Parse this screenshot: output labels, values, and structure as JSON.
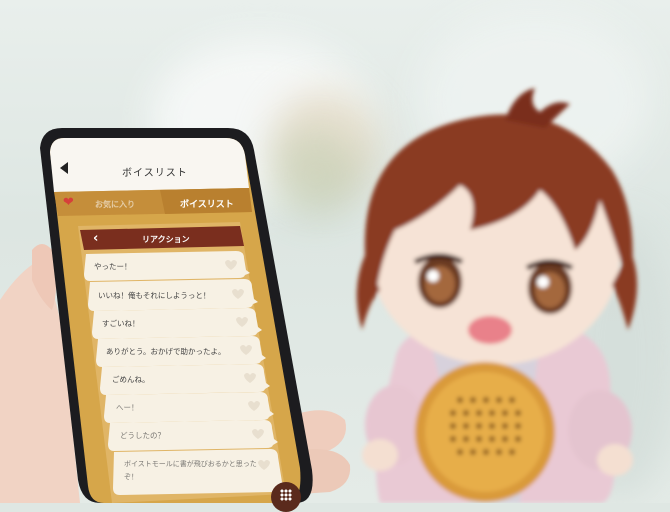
{
  "app": {
    "title": "ボイスリスト",
    "tabs": {
      "favorites": "お気に入り",
      "voicelist": "ボイスリスト"
    },
    "category": "リアクション",
    "voices": [
      "やったー！",
      "いいね！俺もそれにしようっと！",
      "すごいね！",
      "ありがとう。おかげで助かったよ。",
      "ごめんね。",
      "へー！",
      "どうしたの？",
      "ボイストモールに書が飛びおるかと思ったぞ！"
    ]
  },
  "colors": {
    "accent_brown": "#7a2e1e",
    "panel_gold": "#d6a64a",
    "bubble": "#f7f1e4",
    "heart": "#d6403a"
  }
}
